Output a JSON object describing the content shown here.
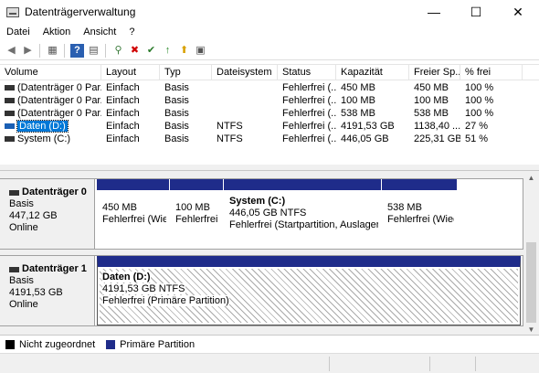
{
  "window": {
    "title": "Datenträgerverwaltung",
    "minimize": "—",
    "maximize": "☐",
    "close": "✕"
  },
  "menu": [
    "Datei",
    "Aktion",
    "Ansicht",
    "?"
  ],
  "toolbar": {
    "back_icon": "◀",
    "forward_icon": "▶",
    "icons": [
      "◀",
      "▶",
      "▦",
      "?",
      "▤",
      "⚲",
      "✖",
      "✔",
      "↑",
      "⬆",
      "▣"
    ]
  },
  "list": {
    "columns": [
      "Volume",
      "Layout",
      "Typ",
      "Dateisystem",
      "Status",
      "Kapazität",
      "Freier Sp...",
      "% frei"
    ],
    "rows": [
      {
        "volume": "(Datenträger 0 Par...",
        "layout": "Einfach",
        "typ": "Basis",
        "fs": "",
        "status": "Fehlerfrei (...",
        "cap": "450 MB",
        "free": "450 MB",
        "pct": "100 %"
      },
      {
        "volume": "(Datenträger 0 Par...",
        "layout": "Einfach",
        "typ": "Basis",
        "fs": "",
        "status": "Fehlerfrei (...",
        "cap": "100 MB",
        "free": "100 MB",
        "pct": "100 %"
      },
      {
        "volume": "(Datenträger 0 Par...",
        "layout": "Einfach",
        "typ": "Basis",
        "fs": "",
        "status": "Fehlerfrei (...",
        "cap": "538 MB",
        "free": "538 MB",
        "pct": "100 %"
      },
      {
        "volume": "Daten (D:)",
        "layout": "Einfach",
        "typ": "Basis",
        "fs": "NTFS",
        "status": "Fehlerfrei (...",
        "cap": "4191,53 GB",
        "free": "1138,40 ...",
        "pct": "27 %"
      },
      {
        "volume": "System (C:)",
        "layout": "Einfach",
        "typ": "Basis",
        "fs": "NTFS",
        "status": "Fehlerfrei (...",
        "cap": "446,05 GB",
        "free": "225,31 GB",
        "pct": "51 %"
      }
    ]
  },
  "disks": [
    {
      "name": "Datenträger 0",
      "type": "Basis",
      "size": "447,12 GB",
      "state": "Online",
      "partitions": [
        {
          "name": "",
          "size": "450 MB",
          "status": "Fehlerfrei (Wiec"
        },
        {
          "name": "",
          "size": "100 MB",
          "status": "Fehlerfrei ("
        },
        {
          "name": "System  (C:)",
          "size": "446,05 GB NTFS",
          "status": "Fehlerfrei (Startpartition, Auslagerur"
        },
        {
          "name": "",
          "size": "538 MB",
          "status": "Fehlerfrei (Wiede"
        }
      ]
    },
    {
      "name": "Datenträger 1",
      "type": "Basis",
      "size": "4191,53 GB",
      "state": "Online",
      "partitions": [
        {
          "name": "Daten  (D:)",
          "size": "4191,53 GB NTFS",
          "status": "Fehlerfrei (Primäre Partition)"
        }
      ]
    }
  ],
  "legend": [
    {
      "label": "Nicht zugeordnet",
      "color": "#000000"
    },
    {
      "label": "Primäre Partition",
      "color": "#1f2c8a"
    }
  ],
  "colors": {
    "partition_header": "#1f2c8a",
    "selection": "#0078d7"
  }
}
